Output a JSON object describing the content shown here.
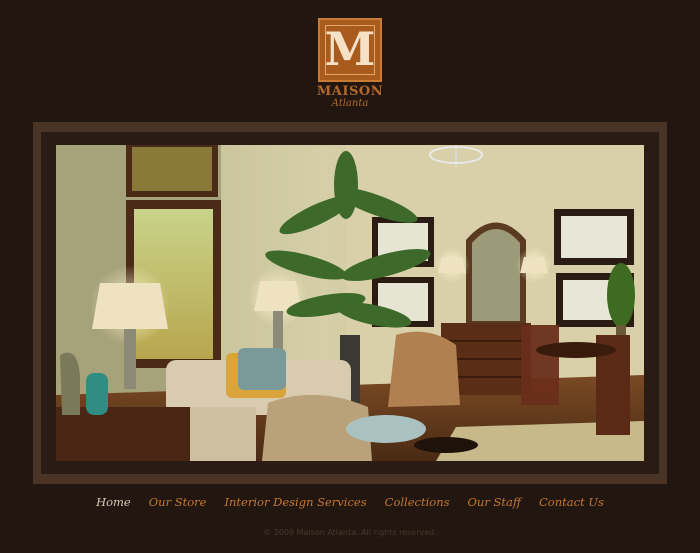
{
  "brand": {
    "logo_letter": "M",
    "name": "MAISON",
    "location": "Atlanta",
    "accent_color": "#a85b1d"
  },
  "hero": {
    "image_subject": "furnished showroom interior"
  },
  "nav": {
    "items": [
      {
        "label": "Home",
        "active": true
      },
      {
        "label": "Our Store",
        "active": false
      },
      {
        "label": "Interior Design Services",
        "active": false
      },
      {
        "label": "Collections",
        "active": false
      },
      {
        "label": "Our Staff",
        "active": false
      },
      {
        "label": "Contact Us",
        "active": false
      }
    ]
  },
  "footer": {
    "copyright": "© 2009 Maison Atlanta. All rights reserved."
  }
}
